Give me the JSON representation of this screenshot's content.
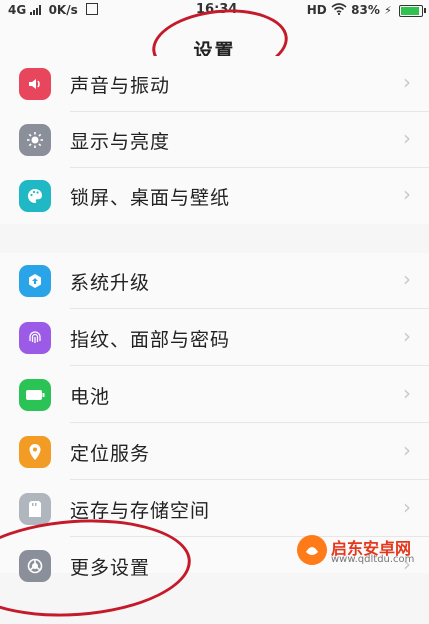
{
  "status_bar": {
    "network": "4G",
    "speed": "0K/s",
    "time": "16:34",
    "hd": "HD",
    "battery_percent": "83%",
    "battery_level": 0.83
  },
  "header": {
    "title": "设置"
  },
  "groups": [
    {
      "items": [
        {
          "label": "声音与振动",
          "icon": "sound-icon",
          "color": "#e8465d"
        },
        {
          "label": "显示与亮度",
          "icon": "brightness-icon",
          "color": "#8a8f99"
        },
        {
          "label": "锁屏、桌面与壁纸",
          "icon": "palette-icon",
          "color": "#20b8c4"
        }
      ]
    },
    {
      "items": [
        {
          "label": "系统升级",
          "icon": "system-update-icon",
          "color": "#2aa4e8"
        },
        {
          "label": "指纹、面部与密码",
          "icon": "fingerprint-icon",
          "color": "#9b5be6"
        },
        {
          "label": "电池",
          "icon": "battery-icon",
          "color": "#2cc356"
        },
        {
          "label": "定位服务",
          "icon": "location-icon",
          "color": "#f39c25"
        },
        {
          "label": "运存与存储空间",
          "icon": "storage-icon",
          "color": "#b0b6bd"
        },
        {
          "label": "更多设置",
          "icon": "more-settings-icon",
          "color": "#8a8f99"
        }
      ]
    }
  ],
  "watermark": {
    "name": "启东安卓网",
    "url": "www.qdltdu.com"
  }
}
